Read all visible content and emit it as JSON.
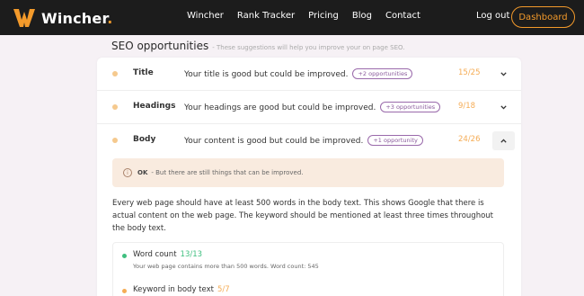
{
  "brand": {
    "name": "Wincher",
    "dot": ".",
    "accent": "#f39a2b"
  },
  "nav": {
    "items": [
      "Wincher",
      "Rank Tracker",
      "Pricing",
      "Blog",
      "Contact"
    ],
    "logout": "Log out",
    "dashboard": "Dashboard"
  },
  "section": {
    "title": "SEO opportunities",
    "subtitle": "- These suggestions will help you improve your on page SEO."
  },
  "rows": [
    {
      "name": "Title",
      "message": "Your title is good but could be improved.",
      "badge": "+2 opportunities",
      "score": "15/25",
      "expanded": false
    },
    {
      "name": "Headings",
      "message": "Your headings are good but could be improved.",
      "badge": "+3 opportunities",
      "score": "9/18",
      "expanded": false
    },
    {
      "name": "Body",
      "message": "Your content is good but could be improved.",
      "badge": "+1 opportunity",
      "score": "24/26",
      "expanded": true
    }
  ],
  "notice": {
    "label": "OK",
    "text": "- But there are still things that can be improved."
  },
  "body_text": "Every web page should have at least 500 words in the body text. This shows Google that there is actual content on the web page. The keyword should be mentioned at least three times throughout the body text.",
  "checks": [
    {
      "title": "Word count",
      "score": "13/13",
      "desc": "Your web page contains more than 500 words. Word count: 545",
      "color": "#3fbf7f"
    },
    {
      "title": "Keyword in body text",
      "score": "5/7",
      "desc": "",
      "color": "#f5ac55"
    }
  ]
}
